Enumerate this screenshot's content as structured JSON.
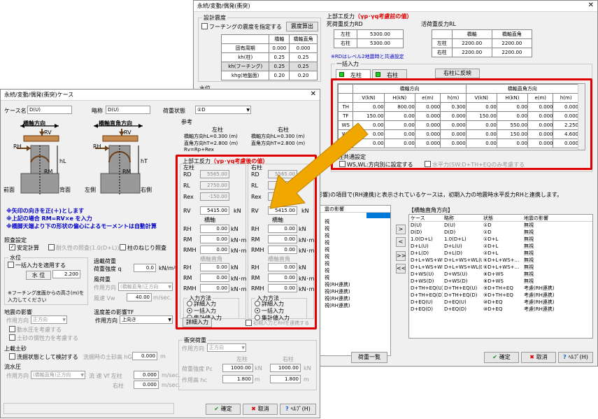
{
  "back": {
    "title": "永続/変動/偶発(衝突)",
    "seismic": {
      "label": "設計震度",
      "check": "フーチングの震度を指定する",
      "calc_btn": "震度算出",
      "headers": [
        "",
        "橋軸",
        "橋軸直角"
      ],
      "rows": [
        [
          "固有周期",
          "0.000",
          "0.000"
        ],
        [
          "kh(柱)",
          "0.25",
          "0.25"
        ],
        [
          "kh(フーチング)",
          "0.25",
          "0.25"
        ],
        [
          "khg(地盤面)",
          "0.20",
          "0.20"
        ]
      ]
    },
    "water_label": "水位",
    "reaction": {
      "label": "上部工反力",
      "note": "（γp･γq考慮前の値）",
      "rd_label": "死荷重反力RD",
      "rl_label": "活荷重反力RL",
      "rd_rows": [
        [
          "左柱",
          "5300.00"
        ],
        [
          "右柱",
          "5300.00"
        ]
      ],
      "rl_headers": [
        "",
        "橋軸",
        "橋軸直角"
      ],
      "rl_rows": [
        [
          "左柱",
          "2200.00",
          "2200.00"
        ],
        [
          "右柱",
          "2200.00",
          "2200.00"
        ]
      ],
      "rd_note": "※RDはレベル2地震時と共通設定"
    },
    "bulk": {
      "label": "一括入力",
      "tab_left": "左柱",
      "tab_right": "右柱",
      "copy_btn": "右柱に反映",
      "group_bridge": "橋軸方向",
      "group_perp": "橋軸直角方向",
      "cols": [
        "V(kN)",
        "H(kN)",
        "e(m)",
        "h(m)",
        "V(kN)",
        "H(kN)",
        "e(m)",
        "h(m)"
      ],
      "rows": [
        [
          "TH",
          "0.00",
          "800.00",
          "0.000",
          "0.300",
          "0.00",
          "0.00",
          "0.000",
          "0.000"
        ],
        [
          "TF",
          "150.00",
          "0.00",
          "0.000",
          "0.000",
          "150.00",
          "0.00",
          "0.000",
          "0.000"
        ],
        [
          "WS",
          "0.00",
          "0.00",
          "0.000",
          "0.000",
          "0.00",
          "550.00",
          "0.000",
          "2.250"
        ],
        [
          "WL",
          "0.00",
          "0.00",
          "0.000",
          "0.000",
          "0.00",
          "150.00",
          "0.000",
          "4.600"
        ],
        [
          "",
          "0.00",
          "0.00",
          "0.000",
          "0.000",
          "0.00",
          "0.00",
          "0.000",
          "0.000"
        ]
      ]
    },
    "common": {
      "label": "柱共通設定",
      "c1": "WS,WL:方向別に設定する",
      "c2": "水平力(SW:D+TH+EQのみ考慮する"
    },
    "info": "影響)の項目で(RH連携)と表示されているケースは，初期入力の地震時水平反力RHと連携します。",
    "left_list": {
      "header": "震の影響",
      "items": [
        "",
        "視",
        "視",
        "視",
        "視",
        "視",
        "視",
        "視",
        "視",
        "視",
        "視(RH連携)",
        "視(RH連携)",
        "視(RH連携)",
        "視(RH連携)"
      ]
    },
    "right_list": {
      "title": "【橋軸直角方向】",
      "headers": [
        "ケース",
        "略称",
        "状態",
        "地震の影響"
      ],
      "rows": [
        [
          "D(U)",
          "D(U)",
          "①D",
          "無視"
        ],
        [
          "D(D)",
          "D(D)",
          "①D",
          "無視"
        ],
        [
          "1.0(D+L)",
          "1.0(D+L)",
          "①D+L",
          "無視"
        ],
        [
          "D+L(U)",
          "D+L(U)",
          "②D+L",
          "無視"
        ],
        [
          "D+L(D)",
          "D+L(D)",
          "②D+L",
          "無視"
        ],
        [
          "D+L+WS+WL(U)",
          "D+L+WS+WL(U)",
          "⑥D+L+WS+...",
          "無視"
        ],
        [
          "D+L+WS+WL(D)",
          "D+L+WS+WL(D)",
          "⑥D+L+WS+...",
          "無視"
        ],
        [
          "D+WS(U)",
          "D+WS(U)",
          "⑧D+WS",
          "無視"
        ],
        [
          "D+WS(D)",
          "D+WS(D)",
          "⑧D+WS",
          "無視"
        ],
        [
          "D+TH+EQ(U)",
          "D+TH+EQ(U)",
          "⑨D+TH+EQ",
          "考慮(RH連携)"
        ],
        [
          "D+TH+EQ(D)",
          "D+TH+EQ(D)",
          "⑨D+TH+EQ",
          "考慮(RH連携)"
        ],
        [
          "D+EQ(U)",
          "D+EQ(U)",
          "⑩D+EQ",
          "考慮(RH連携)"
        ],
        [
          "D+EQ(D)",
          "D+EQ(D)",
          "⑩D+EQ",
          "考慮(RH連携)"
        ]
      ]
    },
    "arrows": [
      ">",
      "<",
      ">>",
      "<<"
    ],
    "load_btn": "荷重一覧",
    "ok": "確定",
    "cancel": "取消",
    "help": "ﾍﾙﾌﾟ(H)"
  },
  "front": {
    "title": "永続/変動/偶発(衝突)ケース",
    "case_label": "ケース名",
    "case_val": "D(U)",
    "abbr_label": "略称",
    "abbr_val": "D(U)",
    "state_label": "荷重状態",
    "state_val": "①D",
    "diag": {
      "bridge_dir": "橋軸方向",
      "perp_dir": "橋軸直角方向",
      "front": "前面",
      "back": "背面",
      "left": "左側",
      "right": "右側",
      "rv": "RV",
      "rh": "RH",
      "rm": "RM",
      "hl": "hL",
      "ht": "hT"
    },
    "notes": [
      "※矢印の向きを正(＋)とします",
      "※上記の場合 RM=RV×e を入力",
      "※橋脚天端より下の形状の偏心によるモーメントは自動計算"
    ],
    "ref": {
      "label": "参考",
      "left": "左柱",
      "right": "右柱",
      "l1": "橋軸方向hL=",
      "l1v": "0.300 (m)",
      "l2": "直角方向hT=",
      "l2v": "2.800 (m)",
      "r1": "橋軸方向hL=",
      "r1v": "0.300 (m)",
      "r2": "直角方向hT=",
      "r2v": "2.800 (m)",
      "f": "Rv=Rp+Rex"
    },
    "sup": {
      "label": "上部工反力",
      "note": "（γp･γq考慮後の値）",
      "left": {
        "title": "左柱",
        "rd": "5565.00",
        "rl": "2750.00",
        "rex": "-150.00",
        "rv": "5415.00",
        "axis1": "橋軸",
        "rh1": "0.00",
        "rm1": "0.00",
        "rmh1": "0.00",
        "axis2": "橋軸直角",
        "rh2": "0.00",
        "rm2": "0.00",
        "rmh2": "0.00"
      },
      "right": {
        "title": "右柱",
        "rd": "5565.00",
        "rl": "2750.00",
        "rex": "-150.00",
        "rv": "5415.00",
        "axis1": "橋軸",
        "rh1": "0.00",
        "rm1": "0.00",
        "rmh1": "0.00",
        "axis2": "橋軸直角",
        "rh2": "0.00",
        "rm2": "0.00",
        "rmh2": "0.00"
      },
      "lbl_rd": "RD",
      "lbl_rl": "RL",
      "lbl_rex": "Rex",
      "lbl_rv": "RV",
      "lbl_rh": "RH",
      "lbl_rm": "RM",
      "lbl_rmh": "RMH",
      "unit_kn": "kN",
      "unit_knm": "kN･m",
      "method": "入力方法",
      "m1": "詳細入力",
      "m2": "一括入力",
      "m3": "集計値入力",
      "detail_btn": "詳細入力",
      "link": "初期入力とRHを連携する"
    },
    "cond": {
      "label": "照査設定",
      "safety": "安定計算",
      "dur": "耐久性の照査(1.0(D+L))",
      "twist": "柱のねじり照査"
    },
    "water": {
      "label": "水位",
      "bulk": "一括入力を適用する",
      "wl": "水 位",
      "wv": "2.200",
      "note": "※フーチング底面からの高さ(m)を入力してください"
    },
    "snow": {
      "label": "過載荷重",
      "sub": "荷重強度  q",
      "v": "0.0",
      "u": "kN/m²"
    },
    "wind": {
      "label": "風荷重",
      "dir": "作用方向",
      "dirv": "(橋軸直角)正方向",
      "speed": "風速 Vw",
      "sv": "40.00",
      "su": "m/sec."
    },
    "quake": {
      "label": "地震の影響",
      "dir": "作用方向",
      "dirv": "正方向",
      "c1": "動水圧を考慮する",
      "c2": "土砂の慣性力を考慮する"
    },
    "temp": {
      "label": "温度差の影響TF",
      "dir": "作用方向",
      "dirv": "上向き"
    },
    "scour": {
      "label": "上載土砂",
      "c": "洗掘状態として検討する",
      "s": "洗掘時の土砂高 hG",
      "v": "0.000",
      "u": "m"
    },
    "flow": {
      "label": "流水圧",
      "dir": "作用方向",
      "dirv": "(橋軸直角)正方向",
      "speed": "流 速 Vf 左柱",
      "v1": "0.000",
      "u": "m/sec.",
      "r": "右柱",
      "v2": "0.000"
    },
    "impact": {
      "label": "衝突荷重",
      "dir": "作用方向",
      "dirv": "正方向",
      "left": "左柱",
      "right": "右柱",
      "load": "荷重強度 Pc",
      "lv": "1000.00",
      "rv": "1000.00",
      "u1": "kN",
      "height": "作用高 hc",
      "lh": "1.800",
      "rh": "1.800",
      "u2": "m"
    },
    "ok": "確定",
    "cancel": "取消",
    "help": "ﾍﾙﾌﾟ(H)"
  },
  "colors": {
    "highlight": "#e00000",
    "arrow": "#f0a800",
    "note_blue": "#0000cc"
  }
}
